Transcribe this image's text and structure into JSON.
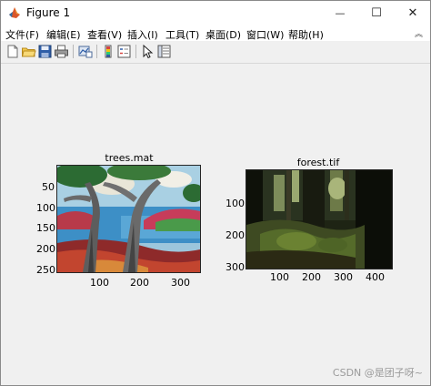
{
  "window": {
    "title": "Figure 1",
    "minimize_glyph": "—",
    "maximize_glyph": "☐",
    "close_glyph": "✕"
  },
  "menubar": {
    "items": [
      {
        "label": "文件(F)"
      },
      {
        "label": "编辑(E)"
      },
      {
        "label": "查看(V)"
      },
      {
        "label": "插入(I)"
      },
      {
        "label": "工具(T)"
      },
      {
        "label": "桌面(D)"
      },
      {
        "label": "窗口(W)"
      },
      {
        "label": "帮助(H)"
      }
    ],
    "overflow_glyph": "︽"
  },
  "toolbar": {
    "buttons": [
      {
        "name": "new-figure-icon"
      },
      {
        "name": "open-file-icon"
      },
      {
        "name": "save-icon"
      },
      {
        "name": "print-icon"
      },
      {
        "name": "link-plot-icon"
      },
      {
        "name": "insert-colorbar-icon"
      },
      {
        "name": "insert-legend-icon"
      },
      {
        "name": "edit-plot-pointer-icon"
      },
      {
        "name": "property-inspector-icon"
      }
    ]
  },
  "axes": [
    {
      "title": "trees.mat",
      "yticks": [
        "50",
        "100",
        "150",
        "200",
        "250"
      ],
      "xticks": [
        "100",
        "200",
        "300"
      ],
      "image": "painting of trees by water"
    },
    {
      "title": "forest.tif",
      "yticks": [
        "100",
        "200",
        "300"
      ],
      "xticks": [
        "100",
        "200",
        "300",
        "400"
      ],
      "image": "photo of dark forest"
    }
  ],
  "watermark": "CSDN @是团子呀~"
}
